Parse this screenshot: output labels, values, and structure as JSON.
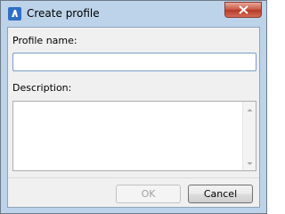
{
  "window": {
    "title": "Create profile",
    "icon": "app-logo-icon",
    "close_icon": "close-icon"
  },
  "form": {
    "profile_name_label": "Profile name:",
    "profile_name_value": "",
    "description_label": "Description:",
    "description_value": ""
  },
  "buttons": {
    "ok_label": "OK",
    "ok_enabled": false,
    "cancel_label": "Cancel"
  },
  "colors": {
    "frame": "#bcd3ea",
    "close_button": "#c7533f",
    "input_focus_border": "#7a9cc9"
  }
}
